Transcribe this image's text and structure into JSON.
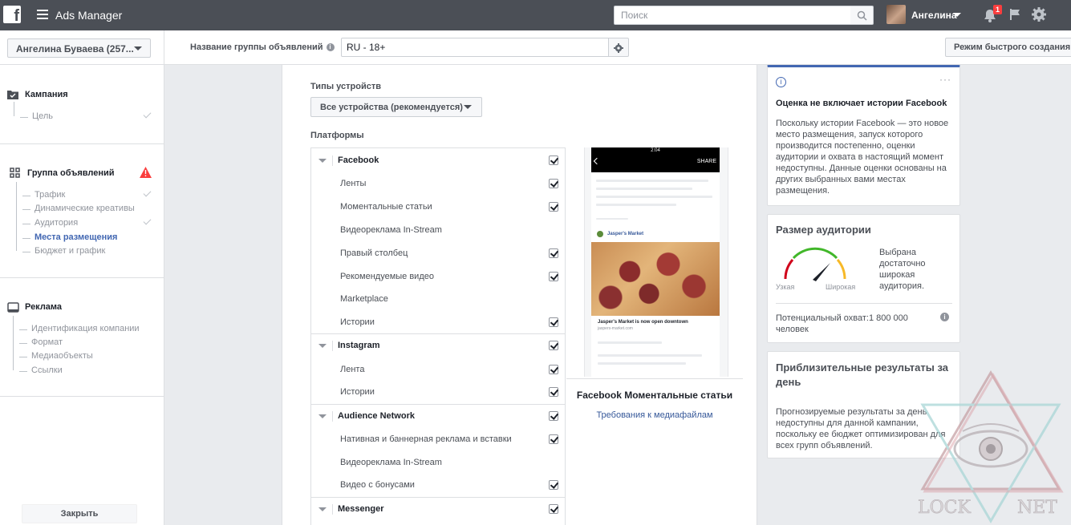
{
  "topbar": {
    "app_title": "Ads Manager",
    "search_placeholder": "Поиск",
    "user_name": "Ангелина",
    "notifications_count": "1"
  },
  "subheader": {
    "account_name": "Ангелина Буваева (257...",
    "adset_label": "Название группы объявлений",
    "adset_name": "RU - 18+",
    "quick_create": "Режим быстрого создания"
  },
  "sidebar": {
    "campaign": {
      "title": "Кампания",
      "items": [
        {
          "label": "Цель",
          "checked": true
        }
      ]
    },
    "adset": {
      "title": "Группа объявлений",
      "warning": true,
      "items": [
        {
          "label": "Трафик",
          "checked": true
        },
        {
          "label": "Динамические креативы",
          "checked": false
        },
        {
          "label": "Аудитория",
          "checked": true
        },
        {
          "label": "Места размещения",
          "active": true
        },
        {
          "label": "Бюджет и график",
          "checked": false
        }
      ]
    },
    "ad": {
      "title": "Реклама",
      "items": [
        {
          "label": "Идентификация компании"
        },
        {
          "label": "Формат"
        },
        {
          "label": "Медиаобъекты"
        },
        {
          "label": "Ссылки"
        }
      ]
    },
    "close_label": "Закрыть"
  },
  "placements": {
    "device_types_label": "Типы устройств",
    "device_types_value": "Все устройства (рекомендуется)",
    "platforms_label": "Платформы",
    "groups": [
      {
        "name": "Facebook",
        "checked": true,
        "items": [
          {
            "label": "Ленты",
            "checked": true
          },
          {
            "label": "Моментальные статьи",
            "checked": true
          },
          {
            "label": "Видеореклама In-Stream",
            "checked": false
          },
          {
            "label": "Правый столбец",
            "checked": true
          },
          {
            "label": "Рекомендуемые видео",
            "checked": true
          },
          {
            "label": "Marketplace",
            "checked": false
          },
          {
            "label": "Истории",
            "checked": true
          }
        ]
      },
      {
        "name": "Instagram",
        "checked": true,
        "items": [
          {
            "label": "Лента",
            "checked": true
          },
          {
            "label": "Истории",
            "checked": true
          }
        ]
      },
      {
        "name": "Audience Network",
        "checked": true,
        "items": [
          {
            "label": "Нативная и баннерная реклама и вставки",
            "checked": true
          },
          {
            "label": "Видеореклама In-Stream",
            "checked": false
          },
          {
            "label": "Видео с бонусами",
            "checked": true
          }
        ]
      },
      {
        "name": "Messenger",
        "checked": true,
        "items": []
      }
    ]
  },
  "preview": {
    "status_time": "2:04",
    "share": "SHARE",
    "page_name": "Jasper's Market",
    "headline": "Jasper's Market is now open downtown",
    "url": "jaspers-market.com",
    "title": "Facebook Моментальные статьи",
    "link": "Требования к медиафайлам"
  },
  "cards": {
    "stories": {
      "title": "Оценка не включает истории Facebook",
      "body": "Поскольку истории Facebook — это новое место размещения, запуск которого производится постепенно, оценки аудитории и охвата в настоящий момент недоступны. Данные оценки основаны на других выбранных вами местах размещения."
    },
    "audience": {
      "title": "Размер аудитории",
      "narrow": "Узкая",
      "wide": "Широкая",
      "summary": "Выбрана достаточно широкая аудитория.",
      "reach": "Потенциальный охват:1 800 000 человек"
    },
    "results": {
      "title": "Приблизительные результаты за день",
      "body": "Прогнозируемые результаты за день недоступны для данной кампании, поскольку ее бюджет оптимизирован для всех групп объявлений."
    }
  },
  "watermark": {
    "left_text": "LOCK",
    "right_text": "NET"
  },
  "colors": {
    "topbar": "#4b4f56",
    "accent": "#4267b2",
    "link": "#365899",
    "warning": "#fa3e3e"
  }
}
